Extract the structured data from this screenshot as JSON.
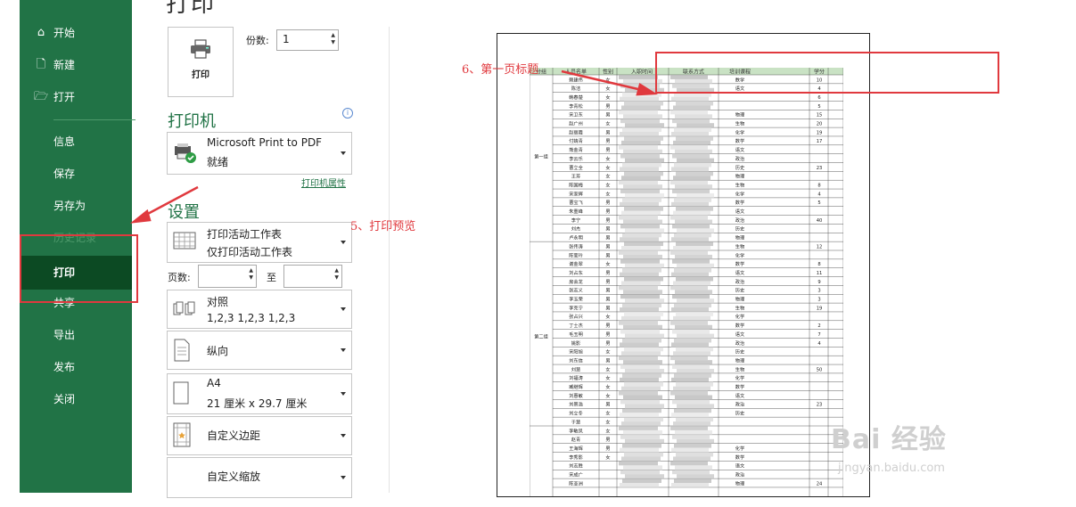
{
  "sidebar": {
    "items": [
      {
        "label": "开始",
        "icon": "home-icon"
      },
      {
        "label": "新建",
        "icon": "new-doc-icon"
      },
      {
        "label": "打开",
        "icon": "folder-open-icon"
      },
      {
        "label": "信息"
      },
      {
        "label": "保存"
      },
      {
        "label": "另存为"
      },
      {
        "label": "历史记录"
      },
      {
        "label": "打印"
      },
      {
        "label": "共享"
      },
      {
        "label": "导出"
      },
      {
        "label": "发布"
      },
      {
        "label": "关闭"
      }
    ],
    "active": "打印"
  },
  "main": {
    "title": "打印",
    "print_button": "打印",
    "copies_label": "份数:",
    "copies_value": "1",
    "printer_section": "打印机",
    "printer_name": "Microsoft Print to PDF",
    "printer_status": "就绪",
    "printer_properties": "打印机属性",
    "settings_section": "设置",
    "settings": [
      {
        "line1": "打印活动工作表",
        "line2": "仅打印活动工作表"
      },
      {
        "line1": "对照",
        "line2": "1,2,3    1,2,3    1,2,3"
      },
      {
        "line1": "纵向",
        "line2": ""
      },
      {
        "line1": "A4",
        "line2": "21 厘米 x 29.7 厘米"
      },
      {
        "line1": "自定义边距",
        "line2": ""
      },
      {
        "line1": "自定义缩放",
        "line2": ""
      }
    ],
    "pages_label": "页数:",
    "to_label": "至"
  },
  "preview": {
    "headers": [
      "分组",
      "人员名单",
      "性别",
      "入职时间",
      "联系方式",
      "培训课程",
      "学分"
    ],
    "groups": [
      "第一组",
      "第二组"
    ],
    "rows": [
      {
        "name": "赖建伟",
        "sex": "女",
        "course": "数学",
        "credit": "10"
      },
      {
        "name": "陈洁",
        "sex": "女",
        "course": "语文",
        "credit": "4"
      },
      {
        "name": "韩春楚",
        "sex": "女",
        "course": "",
        "credit": "6"
      },
      {
        "name": "李青松",
        "sex": "男",
        "course": "",
        "credit": "5"
      },
      {
        "name": "宋卫东",
        "sex": "男",
        "course": "物理",
        "credit": "15"
      },
      {
        "name": "赵广州",
        "sex": "女",
        "course": "生物",
        "credit": "20"
      },
      {
        "name": "赵丽霞",
        "sex": "男",
        "course": "化学",
        "credit": "19"
      },
      {
        "name": "付婧青",
        "sex": "男",
        "course": "数学",
        "credit": "17"
      },
      {
        "name": "熊金青",
        "sex": "男",
        "course": "语文",
        "credit": ""
      },
      {
        "name": "李云乐",
        "sex": "女",
        "course": "政治",
        "credit": ""
      },
      {
        "name": "曹立全",
        "sex": "女",
        "course": "历史",
        "credit": "23"
      },
      {
        "name": "王芳",
        "sex": "女",
        "course": "物理",
        "credit": ""
      },
      {
        "name": "陈国梅",
        "sex": "女",
        "course": "生物",
        "credit": "8"
      },
      {
        "name": "宋家辉",
        "sex": "女",
        "course": "化学",
        "credit": "4"
      },
      {
        "name": "曹宝飞",
        "sex": "男",
        "course": "数学",
        "credit": "5"
      },
      {
        "name": "朱重峰",
        "sex": "男",
        "course": "语文",
        "credit": ""
      },
      {
        "name": "李宁",
        "sex": "男",
        "course": "政治",
        "credit": "40"
      },
      {
        "name": "刘杰",
        "sex": "男",
        "course": "历史",
        "credit": ""
      },
      {
        "name": "卢永明",
        "sex": "男",
        "course": "物理",
        "credit": ""
      },
      {
        "name": "张伟涛",
        "sex": "男",
        "course": "生物",
        "credit": "12"
      },
      {
        "name": "陈莹玲",
        "sex": "男",
        "course": "化学",
        "credit": ""
      },
      {
        "name": "谢金翠",
        "sex": "女",
        "course": "数学",
        "credit": "8"
      },
      {
        "name": "刘占东",
        "sex": "男",
        "course": "语文",
        "credit": "11"
      },
      {
        "name": "房会龙",
        "sex": "男",
        "course": "政治",
        "credit": "9"
      },
      {
        "name": "张志义",
        "sex": "男",
        "course": "历史",
        "credit": "3"
      },
      {
        "name": "李玉荣",
        "sex": "男",
        "course": "物理",
        "credit": "3"
      },
      {
        "name": "李克宁",
        "sex": "男",
        "course": "生物",
        "credit": "19"
      },
      {
        "name": "张占兴",
        "sex": "女",
        "course": "化学",
        "credit": ""
      },
      {
        "name": "丁士杰",
        "sex": "男",
        "course": "数学",
        "credit": "2"
      },
      {
        "name": "毛玉明",
        "sex": "男",
        "course": "语文",
        "credit": "7"
      },
      {
        "name": "姚影",
        "sex": "男",
        "course": "政治",
        "credit": "4"
      },
      {
        "name": "宋阳旭",
        "sex": "女",
        "course": "历史",
        "credit": ""
      },
      {
        "name": "刘东信",
        "sex": "男",
        "course": "物理",
        "credit": ""
      },
      {
        "name": "刘慧",
        "sex": "女",
        "course": "生物",
        "credit": "50"
      },
      {
        "name": "刘福涛",
        "sex": "女",
        "course": "化学",
        "credit": ""
      },
      {
        "name": "臧继辉",
        "sex": "女",
        "course": "数学",
        "credit": ""
      },
      {
        "name": "刘惠敏",
        "sex": "女",
        "course": "语文",
        "credit": ""
      },
      {
        "name": "刘景浩",
        "sex": "男",
        "course": "政治",
        "credit": "23"
      },
      {
        "name": "刘立冬",
        "sex": "女",
        "course": "历史",
        "credit": ""
      },
      {
        "name": "于慧",
        "sex": "女",
        "course": "",
        "credit": ""
      },
      {
        "name": "李敏凤",
        "sex": "女",
        "course": "",
        "credit": ""
      },
      {
        "name": "赵青",
        "sex": "男",
        "course": "",
        "credit": ""
      },
      {
        "name": "王海辉",
        "sex": "男",
        "course": "化学",
        "credit": ""
      },
      {
        "name": "李秀影",
        "sex": "女",
        "course": "数学",
        "credit": ""
      },
      {
        "name": "刘志胜",
        "sex": "",
        "course": "语文",
        "credit": ""
      },
      {
        "name": "宋成广",
        "sex": "",
        "course": "政治",
        "credit": ""
      },
      {
        "name": "陈亚洲",
        "sex": "",
        "course": "物理",
        "credit": "24"
      }
    ]
  },
  "annotations": {
    "step5": "5、打印预览",
    "step6": "6、第一页标题"
  },
  "watermark": {
    "text": "Bai 经验",
    "url": "jingyan.baidu.com"
  },
  "colors": {
    "sidebar": "#217346",
    "sidebar_active": "#0c4a23",
    "annotation": "#e0393e"
  }
}
